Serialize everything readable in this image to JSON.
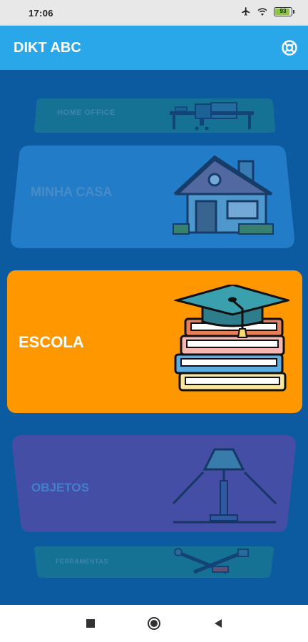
{
  "status_bar": {
    "time": "17:06",
    "battery_level": "93",
    "icons": [
      "airplane-mode-icon",
      "wifi-icon",
      "battery-icon"
    ]
  },
  "app_bar": {
    "title": "DIKT ABC",
    "action_icon": "lifebuoy-icon"
  },
  "categories": [
    {
      "label": "HOME OFFICE",
      "icon": "desk-icon",
      "color": "#1f7a8a"
    },
    {
      "label": "MINHA CASA",
      "icon": "house-icon",
      "color": "#2a86d0"
    },
    {
      "label": "ESCOLA",
      "icon": "graduation-books-icon",
      "color": "#ff9800",
      "selected": true
    },
    {
      "label": "OBJETOS",
      "icon": "lamp-icon",
      "color": "#4a4aa0"
    },
    {
      "label": "FERRAMENTAS",
      "icon": "tools-icon",
      "color": "#1f7a8a"
    }
  ],
  "nav_bar": {
    "buttons": [
      "recents-square-icon",
      "home-circle-icon",
      "back-triangle-icon"
    ]
  }
}
